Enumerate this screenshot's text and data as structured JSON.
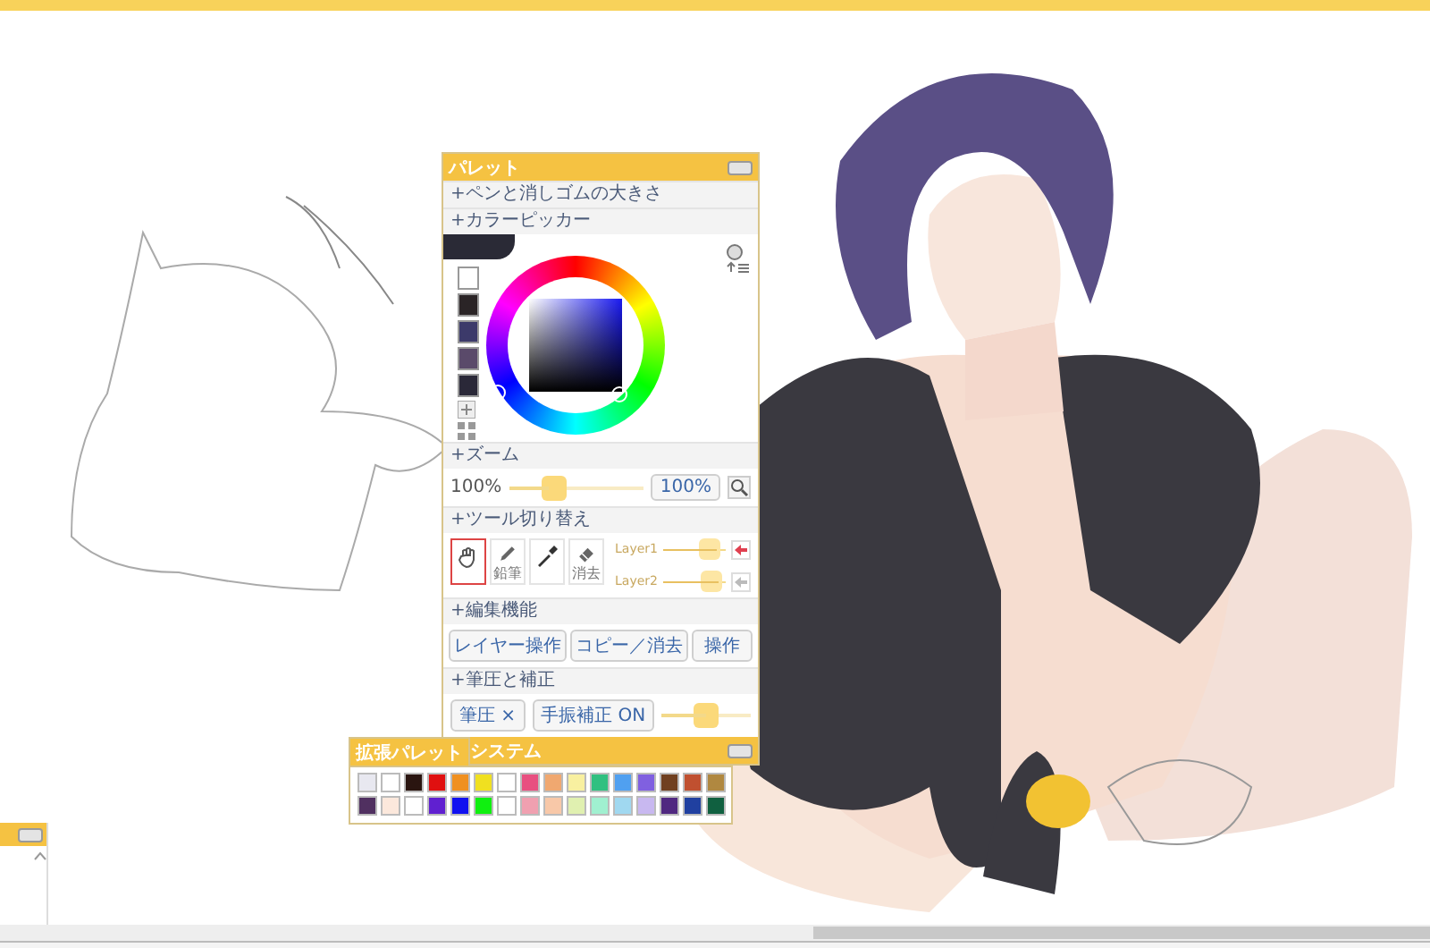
{
  "palette": {
    "title": "パレット",
    "pen_size_header": "+ペンと消しゴムの大きさ",
    "color_picker_header": "+カラーピッカー",
    "recent_colors": [
      {
        "color": "#ffffff"
      },
      {
        "color": "#2a2426"
      },
      {
        "color": "#3c3a6a"
      },
      {
        "color": "#5a4a6a"
      },
      {
        "color": "#2a2838"
      }
    ],
    "zoom": {
      "header": "+ズーム",
      "reading": "100%",
      "level": 0.3,
      "value": "100%"
    },
    "tools": {
      "header": "+ツール切り替え",
      "items": [
        {
          "kind": "hand",
          "selected": true
        },
        {
          "kind": "pencil",
          "label": "鉛筆",
          "selected": false
        },
        {
          "kind": "dropper",
          "selected": false
        },
        {
          "kind": "eraser",
          "label": "消去",
          "selected": false
        }
      ]
    },
    "layers": [
      {
        "name": "Layer1",
        "level": 0.85,
        "disabled": false
      },
      {
        "name": "Layer2",
        "level": 0.9,
        "disabled": true
      }
    ],
    "edit": {
      "header": "+編集機能",
      "buttons": [
        "レイヤー操作",
        "コピー／消去",
        "操作"
      ]
    },
    "pressure": {
      "header": "+筆圧と補正",
      "buttons": [
        "筆圧 ×",
        "手振補正 ON"
      ],
      "level": 0.5
    },
    "system": {
      "title": "システム"
    }
  },
  "extended_palette": {
    "title": "拡張パレット",
    "swatches": [
      {
        "color": "#e8e8f0"
      },
      {
        "color": "#ffffff"
      },
      {
        "color": "#2a1510"
      },
      {
        "color": "#e01010"
      },
      {
        "color": "#f09020"
      },
      {
        "color": "#f0e020"
      },
      {
        "color": "#ffffff"
      },
      {
        "color": "#e85080"
      },
      {
        "color": "#f0a870"
      },
      {
        "color": "#f8f0a0"
      },
      {
        "color": "#30c080"
      },
      {
        "color": "#50a0f0"
      },
      {
        "color": "#8060e0"
      },
      {
        "color": "#704020"
      },
      {
        "color": "#c05030"
      },
      {
        "color": "#b08840"
      },
      {
        "color": "#503060"
      },
      {
        "color": "#fce8dc"
      },
      {
        "color": "#ffffff"
      },
      {
        "color": "#6020d0"
      },
      {
        "color": "#1010f0"
      },
      {
        "color": "#10f010"
      },
      {
        "color": "#ffffff"
      },
      {
        "color": "#f0a0b0"
      },
      {
        "color": "#f8c8a8"
      },
      {
        "color": "#e0f0b0"
      },
      {
        "color": "#a0f0d0"
      },
      {
        "color": "#a0d8f0"
      },
      {
        "color": "#c8b8f0"
      },
      {
        "color": "#502880"
      },
      {
        "color": "#2040a0"
      },
      {
        "color": "#106040"
      }
    ]
  }
}
